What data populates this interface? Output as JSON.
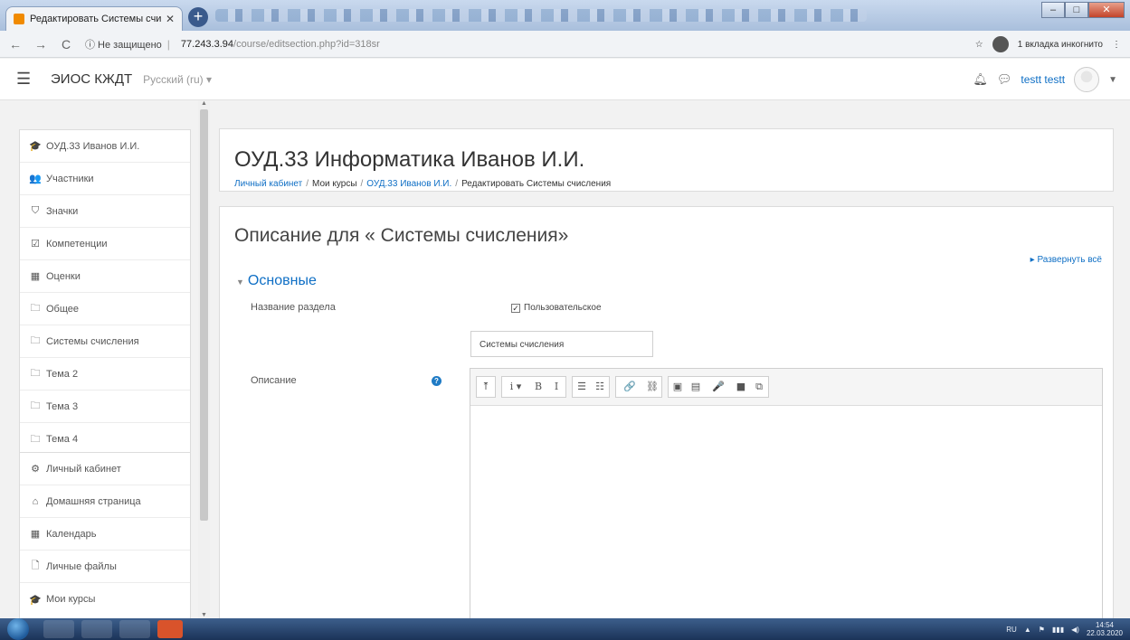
{
  "browser": {
    "tab_title": "Редактировать Системы счисле",
    "tab_close": "✕",
    "newtab_label": "+",
    "url_security": "ⓘ Не защищено",
    "url_host": "77.243.3.94",
    "url_path": "/course/editsection.php?id=318sr",
    "incognito_label": "1 вкладка инкогнито",
    "star_icon": "☆"
  },
  "navbar": {
    "site_name": "ЭИОС КЖДТ",
    "language": "Русский (ru) ▾",
    "user_name": "testt testt"
  },
  "sidebar": {
    "block1": [
      {
        "icon": "graduation-cap-icon",
        "glyph": "🎓",
        "label": "ОУД.33 Иванов И.И."
      },
      {
        "icon": "users-icon",
        "glyph": "👥",
        "label": "Участники"
      },
      {
        "icon": "shield-icon",
        "glyph": "⛉",
        "label": "Значки"
      },
      {
        "icon": "checkbox-icon",
        "glyph": "☑",
        "label": "Компетенции"
      },
      {
        "icon": "table-icon",
        "glyph": "▦",
        "label": "Оценки"
      },
      {
        "icon": "folder-icon",
        "glyph": "🗀",
        "label": "Общее"
      },
      {
        "icon": "folder-icon",
        "glyph": "🗀",
        "label": "Системы счисления"
      },
      {
        "icon": "folder-icon",
        "glyph": "🗀",
        "label": "Тема 2"
      },
      {
        "icon": "folder-icon",
        "glyph": "🗀",
        "label": "Тема 3"
      },
      {
        "icon": "folder-icon",
        "glyph": "🗀",
        "label": "Тема 4"
      }
    ],
    "block2": [
      {
        "icon": "dashboard-icon",
        "glyph": "⚙",
        "label": "Личный кабинет"
      },
      {
        "icon": "home-icon",
        "glyph": "⌂",
        "label": "Домашняя страница"
      },
      {
        "icon": "calendar-icon",
        "glyph": "▦",
        "label": "Календарь"
      },
      {
        "icon": "file-icon",
        "glyph": "🗋",
        "label": "Личные файлы"
      },
      {
        "icon": "graduation-cap-icon",
        "glyph": "🎓",
        "label": "Мои курсы"
      }
    ]
  },
  "header": {
    "course_title": "ОУД.33 Информатика Иванов И.И.",
    "breadcrumb": [
      {
        "text": "Личный кабинет",
        "link": true
      },
      {
        "text": "Мои курсы",
        "link": false
      },
      {
        "text": "ОУД.33 Иванов И.И.",
        "link": true
      },
      {
        "text": "Редактировать Системы счисления",
        "link": false
      }
    ]
  },
  "main": {
    "page_title": "Описание для « Системы счисления»",
    "expand_all": "▸ Развернуть всё",
    "section_title": "Основные",
    "section_name_label": "Название раздела",
    "custom_checkbox_label": "Пользовательское",
    "section_name_value": "Системы счисления",
    "description_label": "Описание",
    "toolbar": [
      [
        "⤒"
      ],
      [
        "i ▾",
        "B",
        "I"
      ],
      [
        "☰",
        "☷"
      ],
      [
        "🔗",
        "⛓"
      ],
      [
        "▣",
        "▤",
        "🎤",
        "■",
        "⧉"
      ]
    ]
  },
  "taskbar": {
    "lang": "RU",
    "time": "14:54",
    "date": "22.03.2020"
  },
  "colors": {
    "link": "#0f6fc5",
    "help": "#1f7bc5"
  }
}
